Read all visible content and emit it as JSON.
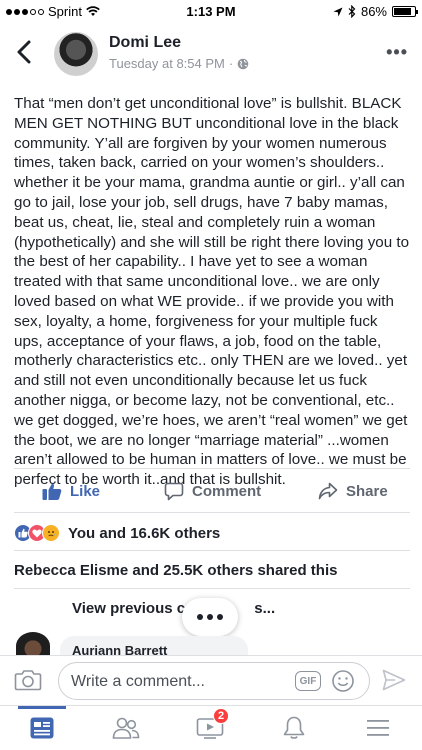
{
  "status_bar": {
    "carrier": "Sprint",
    "time": "1:13 PM",
    "battery": "86%"
  },
  "post": {
    "author": "Domi Lee",
    "timestamp": "Tuesday at 8:54 PM",
    "privacy_sep": "·",
    "body": "That “men don’t get unconditional love” is bullshit. BLACK MEN GET NOTHING BUT unconditional love in the black community. Y’all are forgiven by your women numerous times, taken back, carried on your women’s shoulders.. whether it be your mama, grandma auntie or girl.. y’all can go to jail, lose your job, sell drugs, have 7 baby mamas, beat us, cheat, lie, steal and completely ruin a woman (hypothetically) and she will still be right there loving you to the best of her capability.. I have yet to see a woman treated with that same unconditional love.. we are only loved based on what WE provide.. if we provide you with sex, loyalty, a home, forgiveness for your multiple fuck ups, acceptance of your flaws, a job, food on the table, motherly characteristics etc.. only THEN are we loved.. yet and still not even unconditionally because let us fuck another nigga, or become lazy, not be conventional, etc.. we get dogged, we’re hoes, we aren’t “real women” we get the boot, we are no longer “marriage material” ...women aren’t allowed to be human in matters of love.. we must be perfect to be worth it..and that is bullshit."
  },
  "actions": {
    "like": "Like",
    "comment": "Comment",
    "share": "Share"
  },
  "reactions": {
    "summary": "You and 16.6K others"
  },
  "shares": {
    "text": "Rebecca Elisme and 25.5K others shared this"
  },
  "comments": {
    "view_previous": "View previous co",
    "view_previous_tail": "s...",
    "first_commenter": "Auriann Barrett"
  },
  "composer": {
    "placeholder": "Write a comment...",
    "gif_label": "GIF"
  },
  "tabbar": {
    "video_badge": "2"
  },
  "colors": {
    "brand_blue": "#4267b2",
    "text": "#1d2129",
    "muted": "#90949c",
    "badge_red": "#fa3e3e"
  },
  "icons": [
    "back-chevron-icon",
    "globe-icon",
    "more-icon",
    "like-icon",
    "comment-icon",
    "share-icon",
    "camera-icon",
    "emoji-icon",
    "send-icon",
    "news-feed-icon",
    "friends-icon",
    "video-icon",
    "notifications-icon",
    "menu-icon"
  ]
}
